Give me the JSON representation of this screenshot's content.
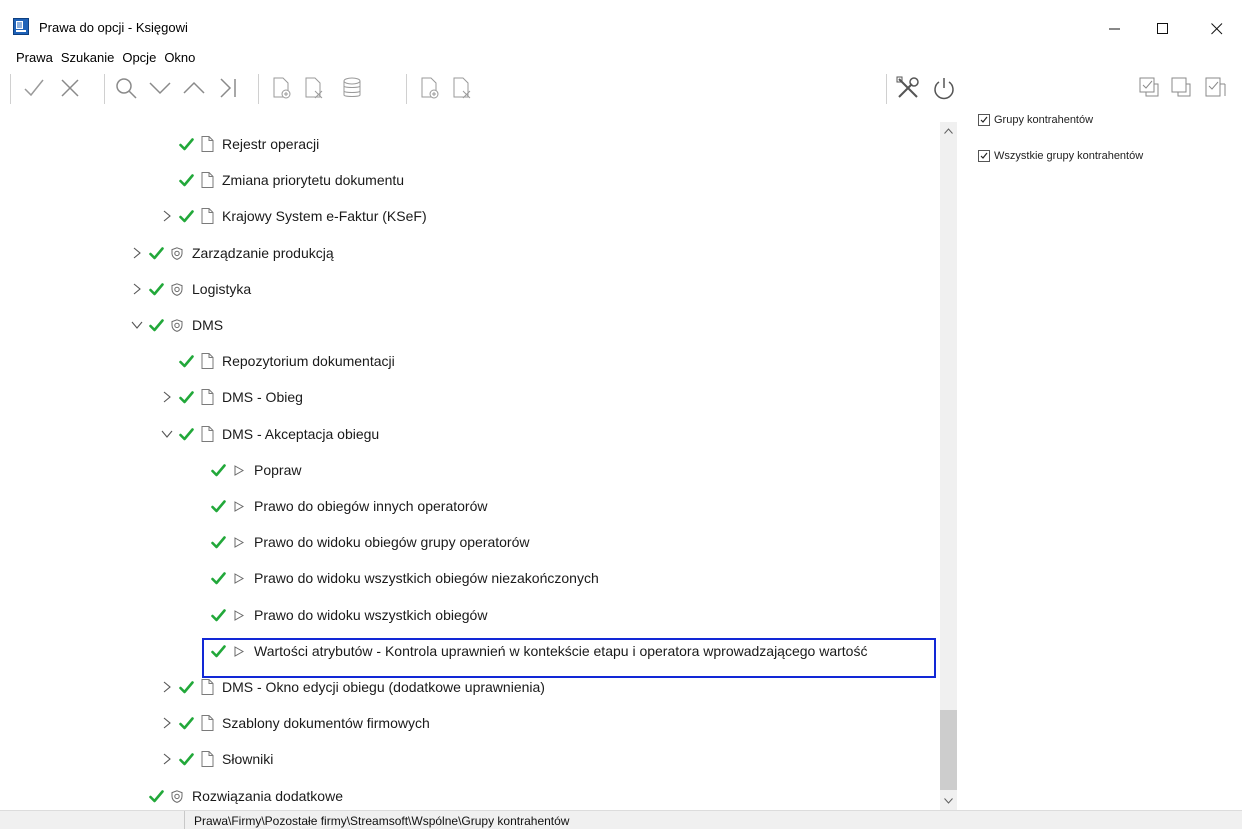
{
  "window": {
    "title": "Prawa do opcji - Księgowi",
    "minimize_glyph": "—",
    "maximize_glyph": "☐",
    "close_glyph": "✕"
  },
  "menu": [
    "Prawa",
    "Szukanie",
    "Opcje",
    "Okno"
  ],
  "toolbar": {
    "left_icons": [
      "check-icon",
      "cross-icon",
      "search-icon",
      "chevron-down-icon",
      "chevron-up-icon",
      "jump-last-icon",
      "add-document-icon",
      "remove-document-icon",
      "database-icon",
      "add-document-icon",
      "remove-document-icon"
    ],
    "right_icons": [
      "tools-icon",
      "power-icon"
    ],
    "far_right_icons": [
      "check-all-icon",
      "uncheck-all-icon",
      "check-page-icon"
    ]
  },
  "tree": [
    {
      "label": "Rejestr operacji",
      "level": 2,
      "expander": "none",
      "icon": "document-icon"
    },
    {
      "label": "Zmiana priorytetu dokumentu",
      "level": 2,
      "expander": "none",
      "icon": "document-icon"
    },
    {
      "label": "Krajowy System e-Faktur (KSeF)",
      "level": 2,
      "expander": "collapsed",
      "icon": "document-icon"
    },
    {
      "label": "Zarządzanie produkcją",
      "level": 1,
      "expander": "collapsed",
      "icon": "shield-icon"
    },
    {
      "label": "Logistyka",
      "level": 1,
      "expander": "collapsed",
      "icon": "shield-icon"
    },
    {
      "label": "DMS",
      "level": 1,
      "expander": "expanded",
      "icon": "shield-icon"
    },
    {
      "label": "Repozytorium dokumentacji",
      "level": 2,
      "expander": "none",
      "icon": "document-icon"
    },
    {
      "label": "DMS - Obieg",
      "level": 2,
      "expander": "collapsed",
      "icon": "document-icon"
    },
    {
      "label": "DMS - Akceptacja obiegu",
      "level": 2,
      "expander": "expanded",
      "icon": "document-icon"
    },
    {
      "label": "Popraw",
      "level": 3,
      "expander": "none",
      "icon": "action-icon"
    },
    {
      "label": "Prawo do obiegów innych operatorów",
      "level": 3,
      "expander": "none",
      "icon": "action-icon"
    },
    {
      "label": "Prawo do widoku obiegów grupy operatorów",
      "level": 3,
      "expander": "none",
      "icon": "action-icon"
    },
    {
      "label": "Prawo do widoku wszystkich obiegów niezakończonych",
      "level": 3,
      "expander": "none",
      "icon": "action-icon"
    },
    {
      "label": "Prawo do widoku wszystkich obiegów",
      "level": 3,
      "expander": "none",
      "icon": "action-icon"
    },
    {
      "label": "Wartości atrybutów - Kontrola uprawnień w kontekście etapu i operatora wprowadzającego wartość",
      "level": 3,
      "expander": "none",
      "icon": "action-icon",
      "selected": true
    },
    {
      "label": "DMS - Okno edycji obiegu (dodatkowe uprawnienia)",
      "level": 2,
      "expander": "collapsed",
      "icon": "document-icon"
    },
    {
      "label": "Szablony dokumentów firmowych",
      "level": 2,
      "expander": "collapsed",
      "icon": "document-icon"
    },
    {
      "label": "Słowniki",
      "level": 2,
      "expander": "collapsed",
      "icon": "document-icon"
    },
    {
      "label": "Rozwiązania dodatkowe",
      "level": 1,
      "expander": "none",
      "icon": "shield-icon"
    }
  ],
  "options": [
    {
      "label": "Grupy kontrahentów",
      "checked": true
    },
    {
      "label": "Wszystkie grupy kontrahentów",
      "checked": true
    }
  ],
  "status": {
    "path": "Prawa\\Firmy\\Pozostałe firmy\\Streamsoft\\Wspólne\\Grupy kontrahentów"
  },
  "colors": {
    "check_green": "#22a83a",
    "selection_border": "#1228d6",
    "icon_gray": "#9a9a9a"
  }
}
